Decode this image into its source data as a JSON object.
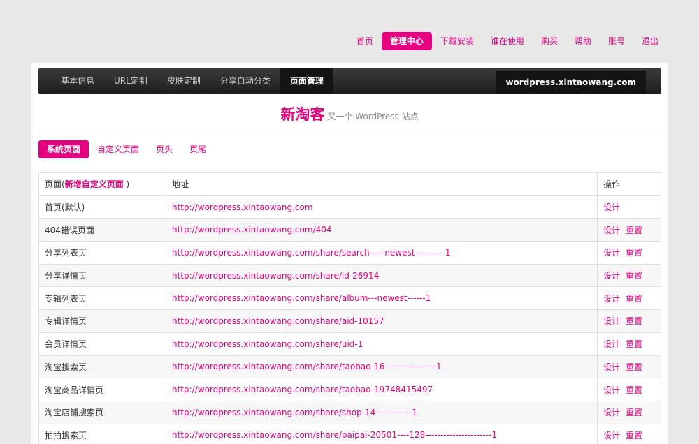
{
  "topnav": [
    {
      "label": "首页",
      "active": false
    },
    {
      "label": "管理中心",
      "active": true
    },
    {
      "label": "下载安装",
      "active": false
    },
    {
      "label": "谁在使用",
      "active": false
    },
    {
      "label": "购买",
      "active": false
    },
    {
      "label": "帮助",
      "active": false
    },
    {
      "label": "账号",
      "active": false
    },
    {
      "label": "退出",
      "active": false
    }
  ],
  "tabs": [
    {
      "label": "基本信息",
      "active": false
    },
    {
      "label": "URL定制",
      "active": false
    },
    {
      "label": "皮肤定制",
      "active": false
    },
    {
      "label": "分享自动分类",
      "active": false
    },
    {
      "label": "页面管理",
      "active": true
    }
  ],
  "domain": "wordpress.xintaowang.com",
  "brand": {
    "name": "新淘客",
    "subtitle": "又一个 WordPress 站点"
  },
  "subtabs": [
    {
      "label": "系统页面",
      "active": true
    },
    {
      "label": "自定义页面",
      "active": false
    },
    {
      "label": "页头",
      "active": false
    },
    {
      "label": "页尾",
      "active": false
    }
  ],
  "table": {
    "headers": {
      "page_prefix": "页面(",
      "page_link": "新增自定义页面",
      "page_suffix": ")",
      "address": "地址",
      "action": "操作"
    },
    "rows": [
      {
        "page": "首页(默认)",
        "url": "http://wordpress.xintaowang.com",
        "design": "设计",
        "reset": ""
      },
      {
        "page": "404错误页面",
        "url": "http://wordpress.xintaowang.com/404",
        "design": "设计",
        "reset": "重置"
      },
      {
        "page": "分享列表页",
        "url": "http://wordpress.xintaowang.com/share/search-----newest----------1",
        "design": "设计",
        "reset": "重置"
      },
      {
        "page": "分享详情页",
        "url": "http://wordpress.xintaowang.com/share/id-26914",
        "design": "设计",
        "reset": "重置"
      },
      {
        "page": "专辑列表页",
        "url": "http://wordpress.xintaowang.com/share/album---newest------1",
        "design": "设计",
        "reset": "重置"
      },
      {
        "page": "专辑详情页",
        "url": "http://wordpress.xintaowang.com/share/aid-10157",
        "design": "设计",
        "reset": "重置"
      },
      {
        "page": "会员详情页",
        "url": "http://wordpress.xintaowang.com/share/uid-1",
        "design": "设计",
        "reset": "重置"
      },
      {
        "page": "淘宝搜索页",
        "url": "http://wordpress.xintaowang.com/share/taobao-16-----------------1",
        "design": "设计",
        "reset": "重置"
      },
      {
        "page": "淘宝商品详情页",
        "url": "http://wordpress.xintaowang.com/share/taobao-19748415497",
        "design": "设计",
        "reset": "重置"
      },
      {
        "page": "淘宝店铺搜索页",
        "url": "http://wordpress.xintaowang.com/share/shop-14------------1",
        "design": "设计",
        "reset": "重置"
      },
      {
        "page": "拍拍搜索页",
        "url": "http://wordpress.xintaowang.com/share/paipai-20501----128----------------------1",
        "design": "设计",
        "reset": "重置"
      }
    ]
  },
  "colors": {
    "accent": "#e5007f",
    "bar": "#222222"
  }
}
